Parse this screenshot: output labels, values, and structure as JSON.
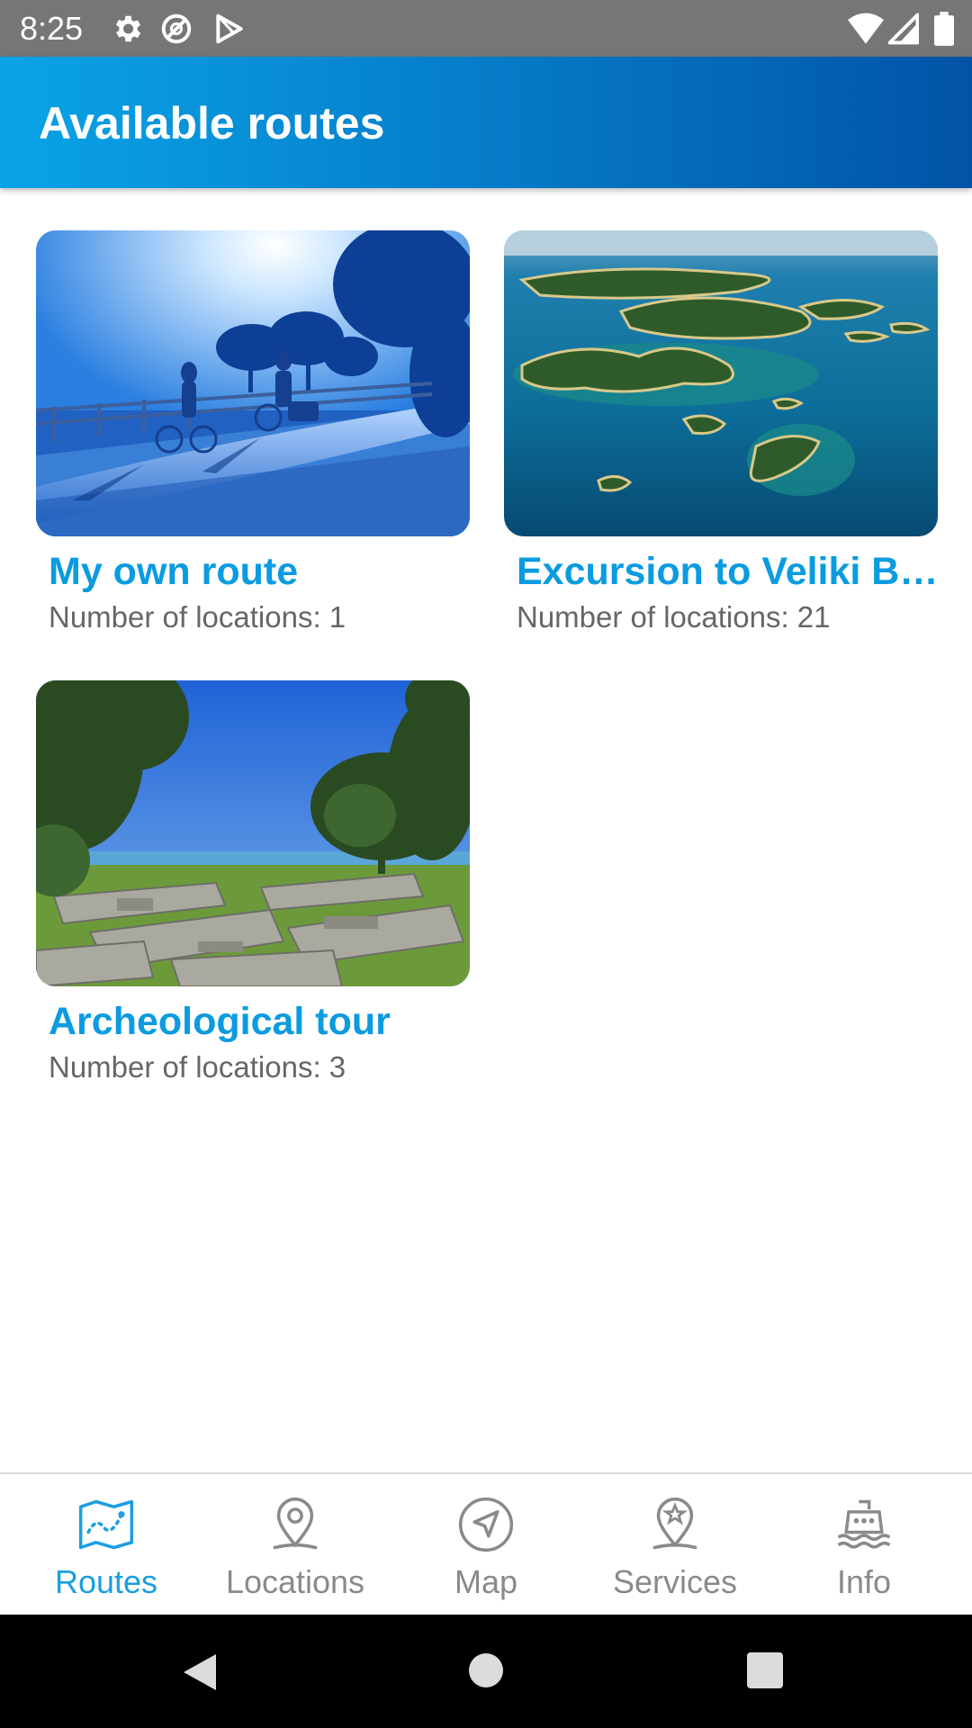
{
  "status_bar": {
    "time": "8:25",
    "icons": [
      "gear-icon",
      "at-sign-icon",
      "play-store-icon",
      "wifi-icon",
      "signal-icon",
      "battery-icon"
    ]
  },
  "header": {
    "title": "Available routes"
  },
  "routes": [
    {
      "title": "My own route",
      "subtitle": "Number of locations: 1",
      "image": "cyclists-on-tree-lined-path-photo"
    },
    {
      "title": "Excursion to Veliki Brijun",
      "subtitle": "Number of locations: 21",
      "image": "aerial-islands-photo"
    },
    {
      "title": "Archeological tour",
      "subtitle": "Number of locations: 3",
      "image": "stone-ruins-by-sea-photo"
    }
  ],
  "bottom_nav": {
    "items": [
      {
        "label": "Routes",
        "icon": "map-route-icon",
        "active": true
      },
      {
        "label": "Locations",
        "icon": "location-pin-icon",
        "active": false
      },
      {
        "label": "Map",
        "icon": "navigation-arrow-icon",
        "active": false
      },
      {
        "label": "Services",
        "icon": "star-pin-icon",
        "active": false
      },
      {
        "label": "Info",
        "icon": "ship-icon",
        "active": false
      }
    ]
  },
  "system_nav": {
    "icons": [
      "back-icon",
      "home-icon",
      "recents-icon"
    ]
  },
  "colors": {
    "accent": "#0a9be0",
    "header_start": "#0aa3e6",
    "header_end": "#0253a6",
    "inactive": "#8a8a8a"
  }
}
